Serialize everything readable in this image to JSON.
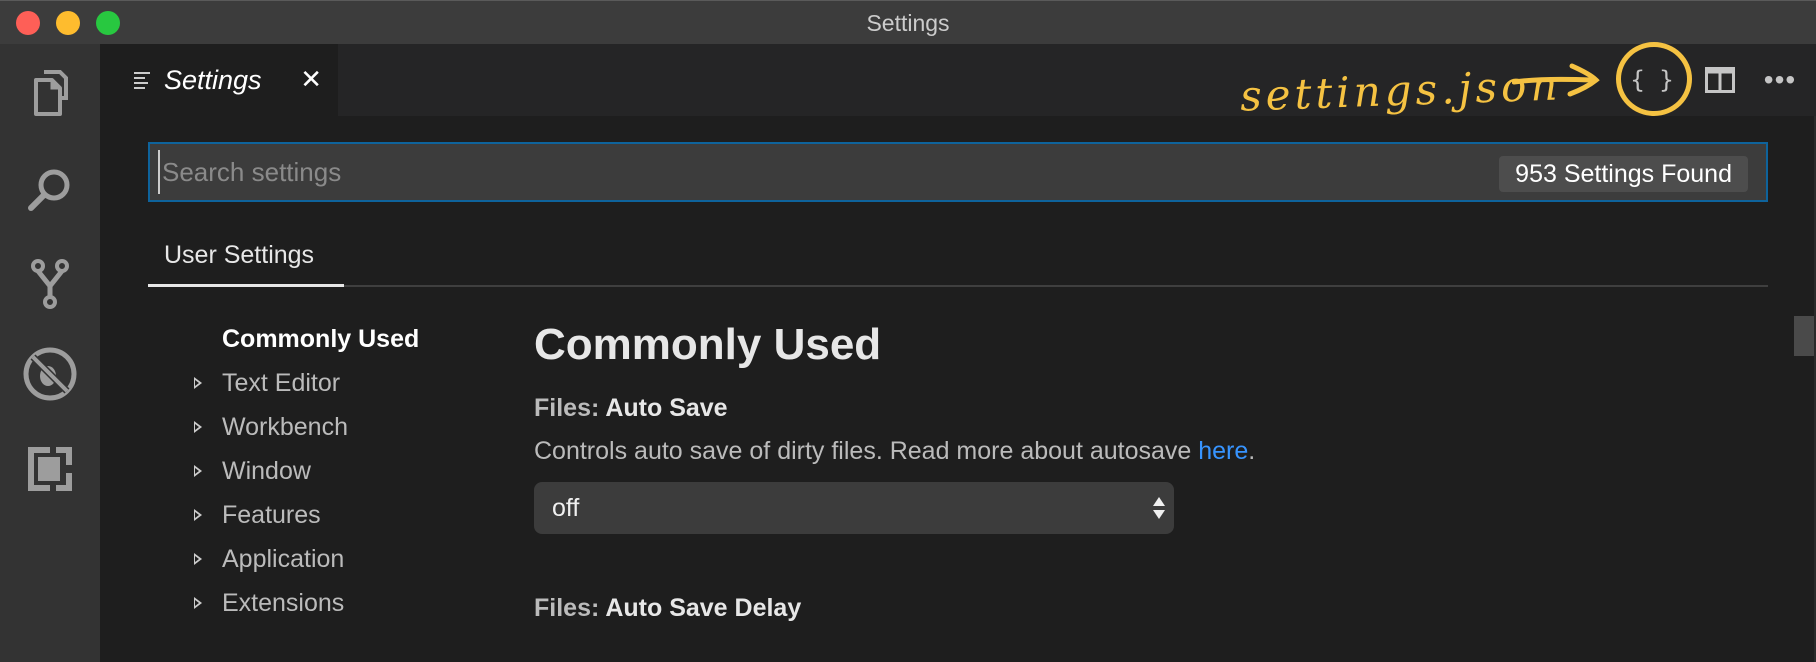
{
  "window": {
    "title": "Settings"
  },
  "activity_bar": {
    "items": [
      {
        "name": "explorer",
        "icon": "files-icon"
      },
      {
        "name": "search",
        "icon": "search-icon"
      },
      {
        "name": "source-control",
        "icon": "git-branch-icon"
      },
      {
        "name": "debug",
        "icon": "no-bug-icon"
      },
      {
        "name": "extensions",
        "icon": "extensions-icon"
      }
    ]
  },
  "tabs": [
    {
      "label": "Settings",
      "icon": "settings-list-icon",
      "active": true,
      "italic": true
    }
  ],
  "editor_actions": {
    "open_json_label": "{ }",
    "split_icon": "split-editor-icon",
    "more_label": "•••"
  },
  "annotation": {
    "text": "settings.json",
    "color": "#f5c242"
  },
  "search": {
    "placeholder": "Search settings",
    "value": "",
    "count_badge": "953 Settings Found"
  },
  "scope_tabs": [
    {
      "label": "User Settings",
      "active": true
    }
  ],
  "toc": {
    "items": [
      {
        "label": "Commonly Used",
        "active": true,
        "expandable": false
      },
      {
        "label": "Text Editor",
        "active": false,
        "expandable": true
      },
      {
        "label": "Workbench",
        "active": false,
        "expandable": true
      },
      {
        "label": "Window",
        "active": false,
        "expandable": true
      },
      {
        "label": "Features",
        "active": false,
        "expandable": true
      },
      {
        "label": "Application",
        "active": false,
        "expandable": true
      },
      {
        "label": "Extensions",
        "active": false,
        "expandable": true
      }
    ]
  },
  "main": {
    "section_title": "Commonly Used",
    "settings": [
      {
        "category": "Files: ",
        "name": "Auto Save",
        "description": "Controls auto save of dirty files. Read more about autosave ",
        "link_text": "here",
        "description_suffix": ".",
        "value": "off"
      },
      {
        "category": "Files: ",
        "name": "Auto Save Delay"
      }
    ]
  },
  "colors": {
    "accent_border": "#0e639c",
    "link": "#3794ff",
    "annotation": "#f5c242"
  }
}
